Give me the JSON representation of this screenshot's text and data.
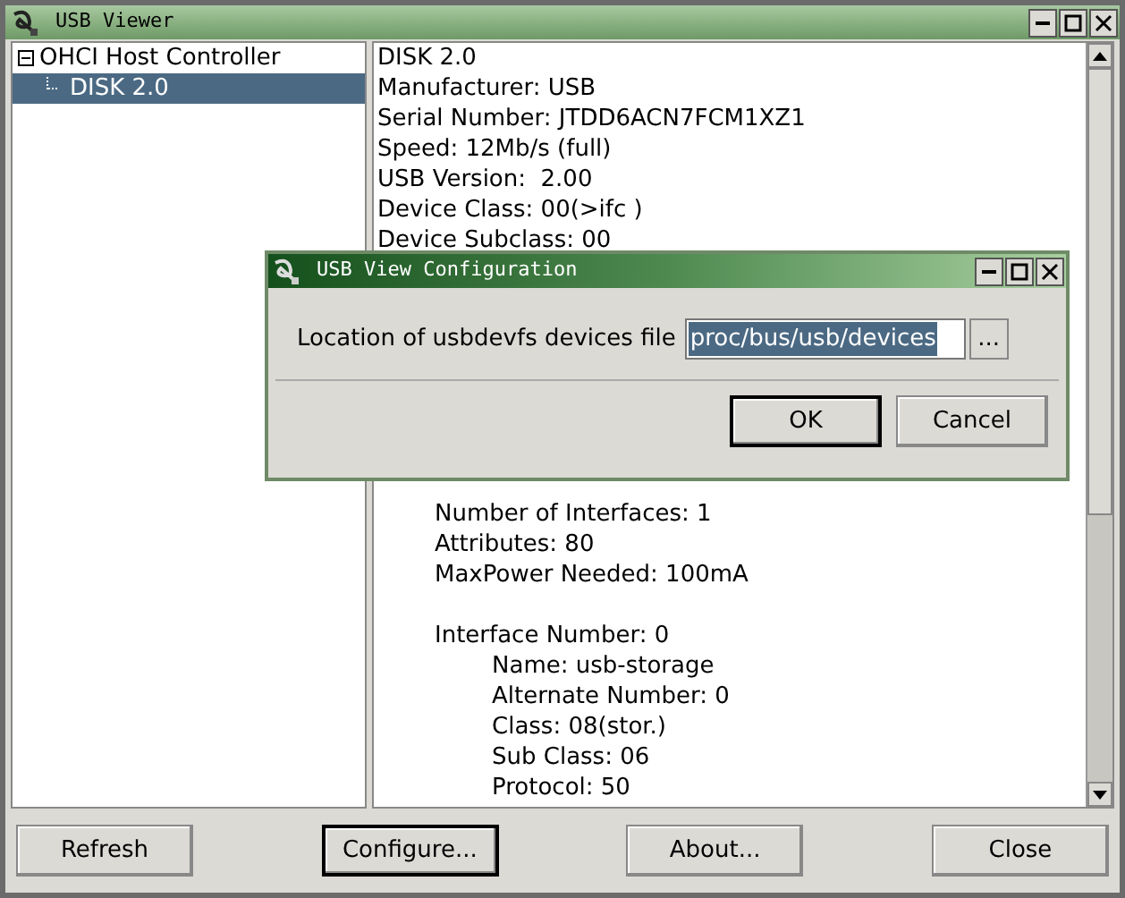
{
  "window": {
    "title": "USB Viewer"
  },
  "tree": [
    {
      "label": "OHCI Host Controller",
      "expanded": true,
      "selected": false,
      "children": [
        {
          "label": "DISK 2.0",
          "selected": true
        }
      ]
    }
  ],
  "details_top": [
    "DISK 2.0",
    "Manufacturer: USB",
    "Serial Number: JTDD6ACN7FCM1XZ1",
    "Speed: 12Mb/s (full)",
    "USB Version:  2.00",
    "Device Class: 00(>ifc )",
    "Device Subclass: 00"
  ],
  "details_bottom": [
    {
      "text": "Number of Interfaces: 1"
    },
    {
      "text": "Attributes: 80"
    },
    {
      "text": "MaxPower Needed: 100mA"
    },
    {
      "text": "Interface Number: 0",
      "children": [
        {
          "text": "Name: usb-storage"
        },
        {
          "text": "Alternate Number: 0"
        },
        {
          "text": "Class: 08(stor.)"
        },
        {
          "text": "Sub Class: 06"
        },
        {
          "text": "Protocol: 50"
        }
      ]
    }
  ],
  "buttons": [
    {
      "label": "Refresh",
      "focused": false
    },
    {
      "label": "Configure...",
      "focused": true
    },
    {
      "label": "About...",
      "focused": false
    },
    {
      "label": "Close",
      "focused": false
    }
  ],
  "dialog": {
    "title": "USB View Configuration",
    "field_label": "Location of usbdevfs devices file",
    "field_value": "proc/bus/usb/devices",
    "value_selected": true,
    "browse_label": "...",
    "buttons": [
      {
        "label": "OK",
        "focused": true
      },
      {
        "label": "Cancel",
        "focused": false
      }
    ]
  }
}
